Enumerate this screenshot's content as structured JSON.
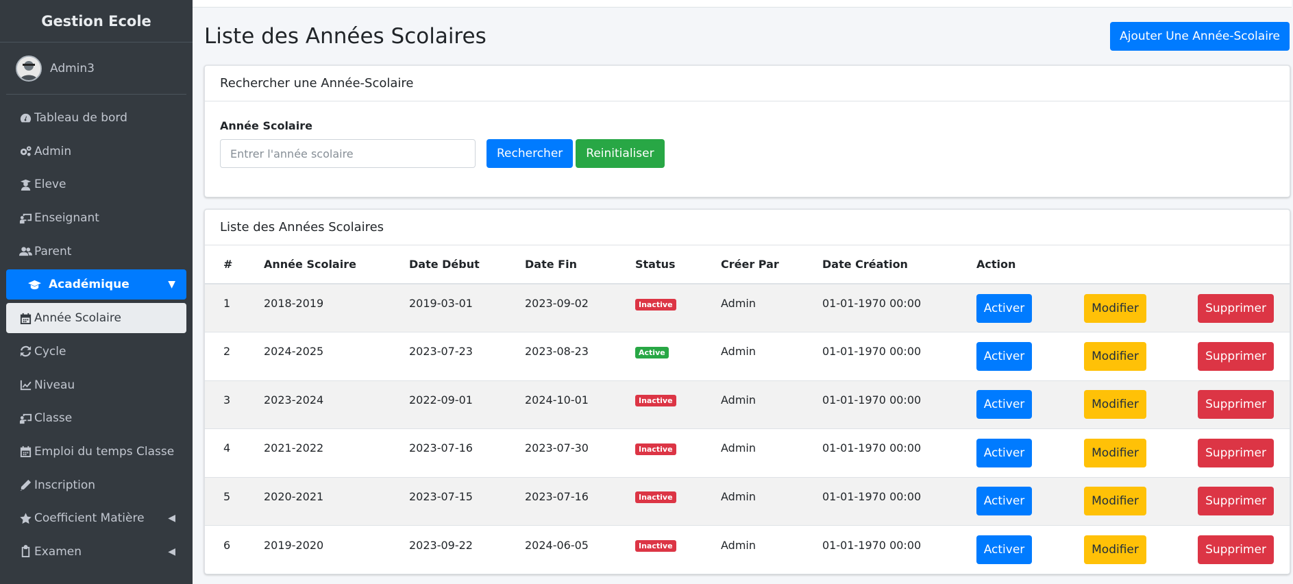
{
  "sidebar": {
    "brand": "Gestion Ecole",
    "user": "Admin3",
    "items": [
      {
        "label": "Tableau de bord",
        "icon": "tachometer-icon"
      },
      {
        "label": "Admin",
        "icon": "cogs-icon"
      },
      {
        "label": "Eleve",
        "icon": "graduate-icon"
      },
      {
        "label": "Enseignant",
        "icon": "chalkboard-teacher-icon"
      },
      {
        "label": "Parent",
        "icon": "users-icon"
      },
      {
        "label": "Académique",
        "icon": "graduation-cap-icon"
      },
      {
        "label": "Année Scolaire",
        "icon": "calendar-icon"
      },
      {
        "label": "Cycle",
        "icon": "sync-icon"
      },
      {
        "label": "Niveau",
        "icon": "chart-line-icon"
      },
      {
        "label": "Classe",
        "icon": "chalkboard-icon"
      },
      {
        "label": "Emploi du temps Classe",
        "icon": "calendar-icon"
      },
      {
        "label": "Inscription",
        "icon": "pen-icon"
      },
      {
        "label": "Coefficient Matière",
        "icon": "star-icon"
      },
      {
        "label": "Examen",
        "icon": "clipboard-icon"
      }
    ]
  },
  "header": {
    "title": "Liste des Années Scolaires",
    "add_button": "Ajouter Une Année-Scolaire"
  },
  "search": {
    "card_title": "Rechercher une Année-Scolaire",
    "label": "Année Scolaire",
    "placeholder": "Entrer l'année scolaire",
    "value": "",
    "search_button": "Rechercher",
    "reset_button": "Reinitialiser"
  },
  "list": {
    "card_title": "Liste des Années Scolaires",
    "columns": [
      "#",
      "Année Scolaire",
      "Date Début",
      "Date Fin",
      "Status",
      "Créer Par",
      "Date Création",
      "Action"
    ],
    "rows": [
      {
        "num": "1",
        "annee": "2018-2019",
        "debut": "2019-03-01",
        "fin": "2023-09-02",
        "status": "Inactive",
        "par": "Admin",
        "creation": "01-01-1970 00:00"
      },
      {
        "num": "2",
        "annee": "2024-2025",
        "debut": "2023-07-23",
        "fin": "2023-08-23",
        "status": "Active",
        "par": "Admin",
        "creation": "01-01-1970 00:00"
      },
      {
        "num": "3",
        "annee": "2023-2024",
        "debut": "2022-09-01",
        "fin": "2024-10-01",
        "status": "Inactive",
        "par": "Admin",
        "creation": "01-01-1970 00:00"
      },
      {
        "num": "4",
        "annee": "2021-2022",
        "debut": "2023-07-16",
        "fin": "2023-07-30",
        "status": "Inactive",
        "par": "Admin",
        "creation": "01-01-1970 00:00"
      },
      {
        "num": "5",
        "annee": "2020-2021",
        "debut": "2023-07-15",
        "fin": "2023-07-16",
        "status": "Inactive",
        "par": "Admin",
        "creation": "01-01-1970 00:00"
      },
      {
        "num": "6",
        "annee": "2019-2020",
        "debut": "2023-09-22",
        "fin": "2024-06-05",
        "status": "Inactive",
        "par": "Admin",
        "creation": "01-01-1970 00:00"
      }
    ],
    "actions": {
      "activate": "Activer",
      "edit": "Modifier",
      "delete": "Supprimer"
    }
  },
  "colors": {
    "sidebar_bg": "#343a40",
    "primary": "#007bff",
    "success": "#28a745",
    "warning": "#ffc107",
    "danger": "#dc3545"
  }
}
